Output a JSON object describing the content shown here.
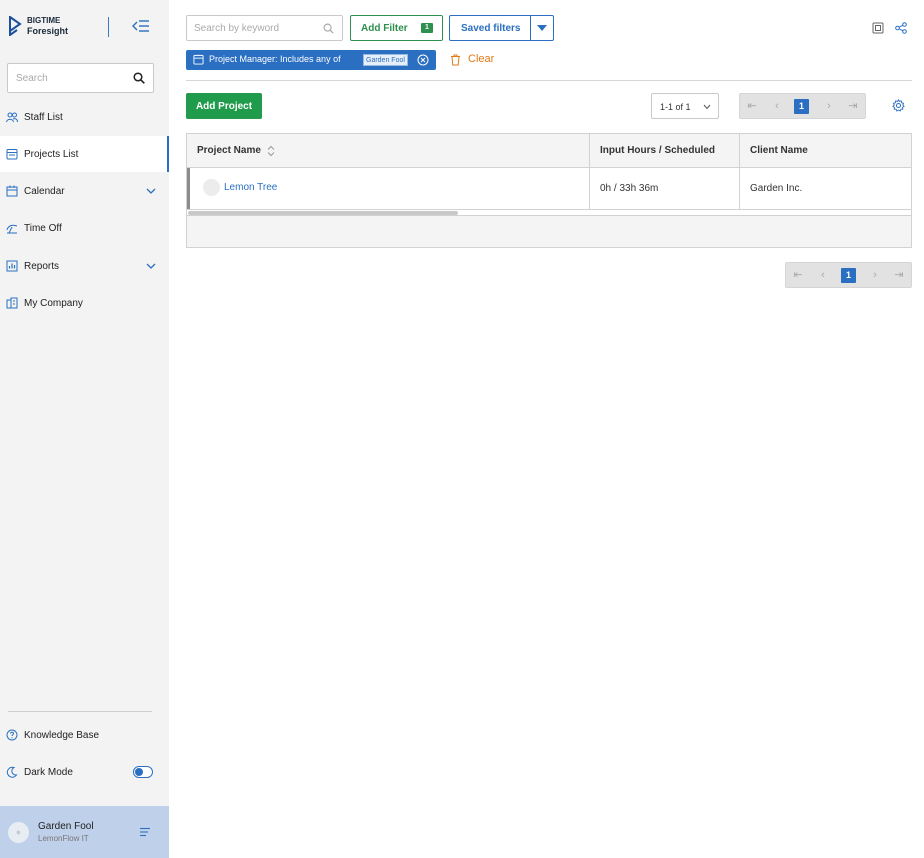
{
  "app": {
    "logo_line1": "BIGTIME",
    "logo_line2": "Foresight"
  },
  "sidebar": {
    "search_placeholder": "Search",
    "items": [
      {
        "label": "Staff List",
        "icon": "staff-icon"
      },
      {
        "label": "Projects List",
        "icon": "projects-icon",
        "active": true
      },
      {
        "label": "Calendar",
        "icon": "calendar-icon",
        "expandable": true
      },
      {
        "label": "Time Off",
        "icon": "time-off-icon"
      },
      {
        "label": "Reports",
        "icon": "reports-icon",
        "expandable": true
      },
      {
        "label": "My Company",
        "icon": "company-icon"
      }
    ],
    "knowledge_base": "Knowledge Base",
    "dark_mode": "Dark Mode",
    "dark_mode_on": true,
    "user": {
      "name": "Garden Fool",
      "org": "LemonFlow IT"
    }
  },
  "toolbar": {
    "search_placeholder": "Search by keyword",
    "add_filter_label": "Add Filter",
    "filter_count": "1",
    "saved_filters_label": "Saved filters"
  },
  "filter_chip": {
    "label": "Project Manager:  Includes any of",
    "value": "Garden Fool"
  },
  "clear_label": "Clear",
  "actions": {
    "add_project_label": "Add Project",
    "range_label": "1-1 of 1",
    "current_page": "1"
  },
  "table": {
    "columns": [
      "Project Name",
      "Input Hours / Scheduled",
      "Client Name"
    ],
    "rows": [
      {
        "project": "Lemon Tree",
        "hours": "0h / 33h 36m",
        "client": "Garden Inc."
      }
    ]
  },
  "colors": {
    "accent_blue": "#2a6fc1",
    "green": "#1f9b4b",
    "clear_orange": "#e07a18",
    "user_box": "#bfd1ea"
  }
}
